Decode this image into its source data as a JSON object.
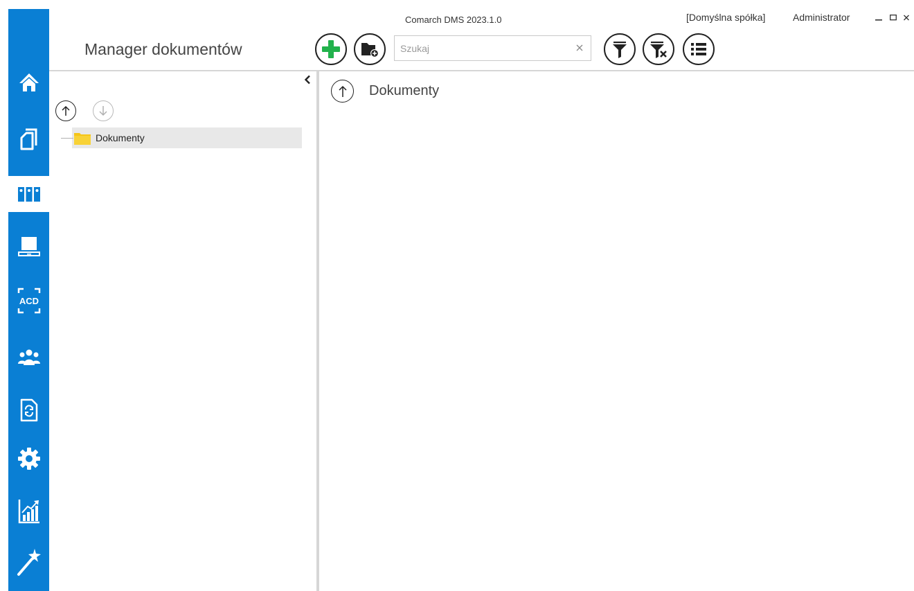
{
  "window": {
    "app_title": "Comarch DMS 2023.1.0",
    "company": "[Domyślna spółka]",
    "user": "Administrator",
    "controls": [
      "minimize",
      "maximize",
      "close"
    ]
  },
  "page": {
    "title": "Manager dokumentów"
  },
  "toolbar": {
    "buttons": [
      {
        "name": "add-document-button",
        "icon": "plus-icon"
      },
      {
        "name": "add-folder-button",
        "icon": "folder-add-icon"
      },
      {
        "name": "filter-button",
        "icon": "filter-icon"
      },
      {
        "name": "clear-filter-button",
        "icon": "filter-clear-icon"
      },
      {
        "name": "list-view-button",
        "icon": "list-icon"
      }
    ],
    "search": {
      "placeholder": "Szukaj",
      "value": ""
    }
  },
  "sidebar": {
    "items": [
      {
        "icon": "home-icon",
        "active": false
      },
      {
        "icon": "documents-icon",
        "active": false
      },
      {
        "icon": "binders-icon",
        "active": true
      },
      {
        "icon": "workstation-icon",
        "active": false
      },
      {
        "icon": "acd-icon",
        "active": false
      },
      {
        "icon": "users-icon",
        "active": false
      },
      {
        "icon": "document-sync-icon",
        "active": false
      },
      {
        "icon": "gear-icon",
        "active": false
      },
      {
        "icon": "report-chart-icon",
        "active": false
      },
      {
        "icon": "magic-wand-icon",
        "active": false
      }
    ]
  },
  "tree": {
    "items": [
      {
        "label": "Dokumenty",
        "selected": true
      }
    ]
  },
  "content": {
    "title": "Dokumenty"
  },
  "colors": {
    "rail": "#0a7fd4",
    "add_icon": "#22b24c",
    "folder": "#f5c518",
    "selection": "#e8e8e8",
    "divider": "#d6d6d6"
  }
}
